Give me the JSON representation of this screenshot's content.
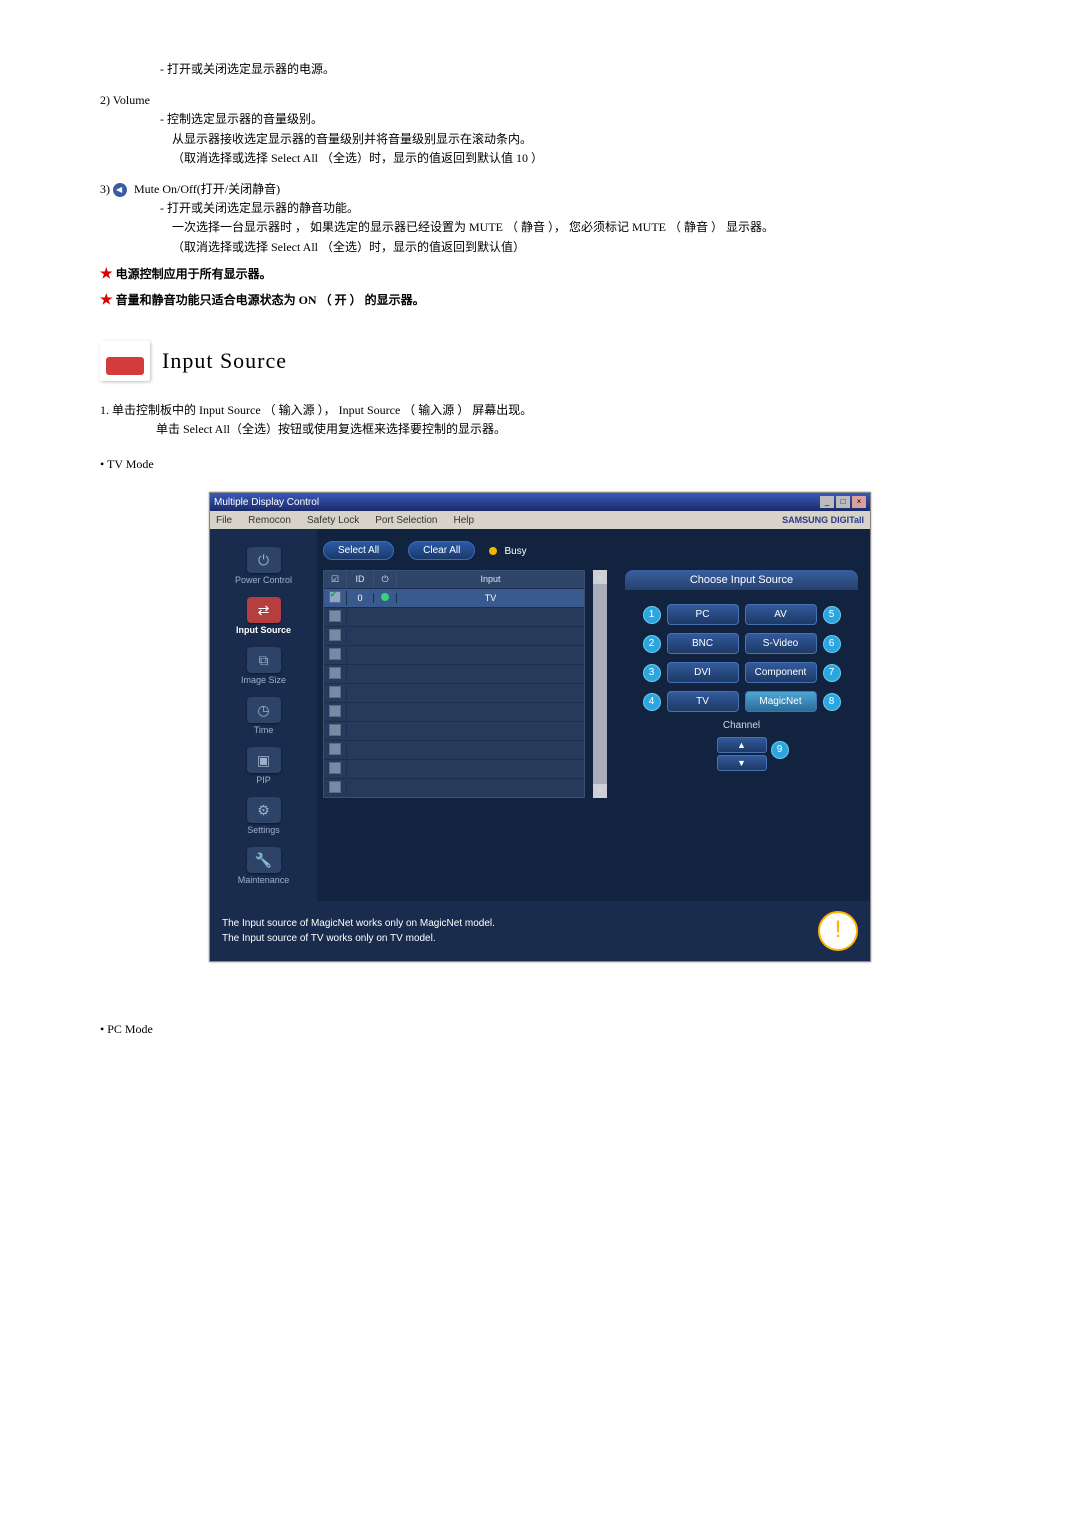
{
  "top": {
    "power_desc": "- 打开或关闭选定显示器的电源。",
    "vol_num": "2)",
    "vol_label": "Volume",
    "vol_desc1": "- 控制选定显示器的音量级别。",
    "vol_desc2": "从显示器接收选定显示器的音量级别并将音量级别显示在滚动条内。",
    "vol_desc3": "（取消选择或选择 Select All （全选）时，显示的值返回到默认值 10 ）",
    "mute_num": "3)",
    "mute_label": "Mute On/Off(打开/关闭静音)",
    "mute_desc1": "- 打开或关闭选定显示器的静音功能。",
    "mute_desc2": "一次选择一台显示器时 ， 如果选定的显示器已经设置为 MUTE （ 静音 ），  您必须标记 MUTE （ 静音 ） 显示器。",
    "mute_desc3": "（取消选择或选择 Select All （全选）时，显示的值返回到默认值）",
    "star1": "电源控制应用于所有显示器。",
    "star2": "音量和静音功能只适合电源状态为 ON （ 开 ） 的显示器。"
  },
  "section_title": "Input Source",
  "steps": {
    "s1_num": "1.",
    "s1": "单击控制板中的 Input Source （ 输入源 ）， Input Source （ 输入源 ） 屏幕出现。",
    "s1b": "单击 Select All（全选）按钮或使用复选框来选择要控制的显示器。"
  },
  "tv_mode_label": "• TV Mode",
  "pc_mode_label": "• PC Mode",
  "app": {
    "title": "Multiple Display Control",
    "menu": {
      "file": "File",
      "remocon": "Remocon",
      "safety": "Safety Lock",
      "port": "Port Selection",
      "help": "Help",
      "brand": "SAMSUNG DIGITall"
    },
    "sidebar": {
      "power": "Power Control",
      "input": "Input Source",
      "image": "Image Size",
      "time": "Time",
      "pip": "PIP",
      "settings": "Settings",
      "maint": "Maintenance"
    },
    "toolbar": {
      "select_all": "Select All",
      "clear_all": "Clear All",
      "busy": "Busy"
    },
    "table": {
      "hdr_chk": "☑",
      "hdr_id": "ID",
      "hdr_pwr": "⏻",
      "hdr_input": "Input",
      "row1_id": "0",
      "row1_input": "TV"
    },
    "right": {
      "heading": "Choose Input Source",
      "pc": "PC",
      "av": "AV",
      "bnc": "BNC",
      "svideo": "S-Video",
      "dvi": "DVI",
      "component": "Component",
      "tv": "TV",
      "magicnet": "MagicNet",
      "channel": "Channel",
      "up": "▲",
      "down": "▼",
      "c1": "1",
      "c2": "2",
      "c3": "3",
      "c4": "4",
      "c5": "5",
      "c6": "6",
      "c7": "7",
      "c8": "8",
      "c9": "9"
    },
    "footer": {
      "line1": "The Input source of MagicNet works only on MagicNet model.",
      "line2": "The Input source of TV works only on TV  model."
    }
  }
}
